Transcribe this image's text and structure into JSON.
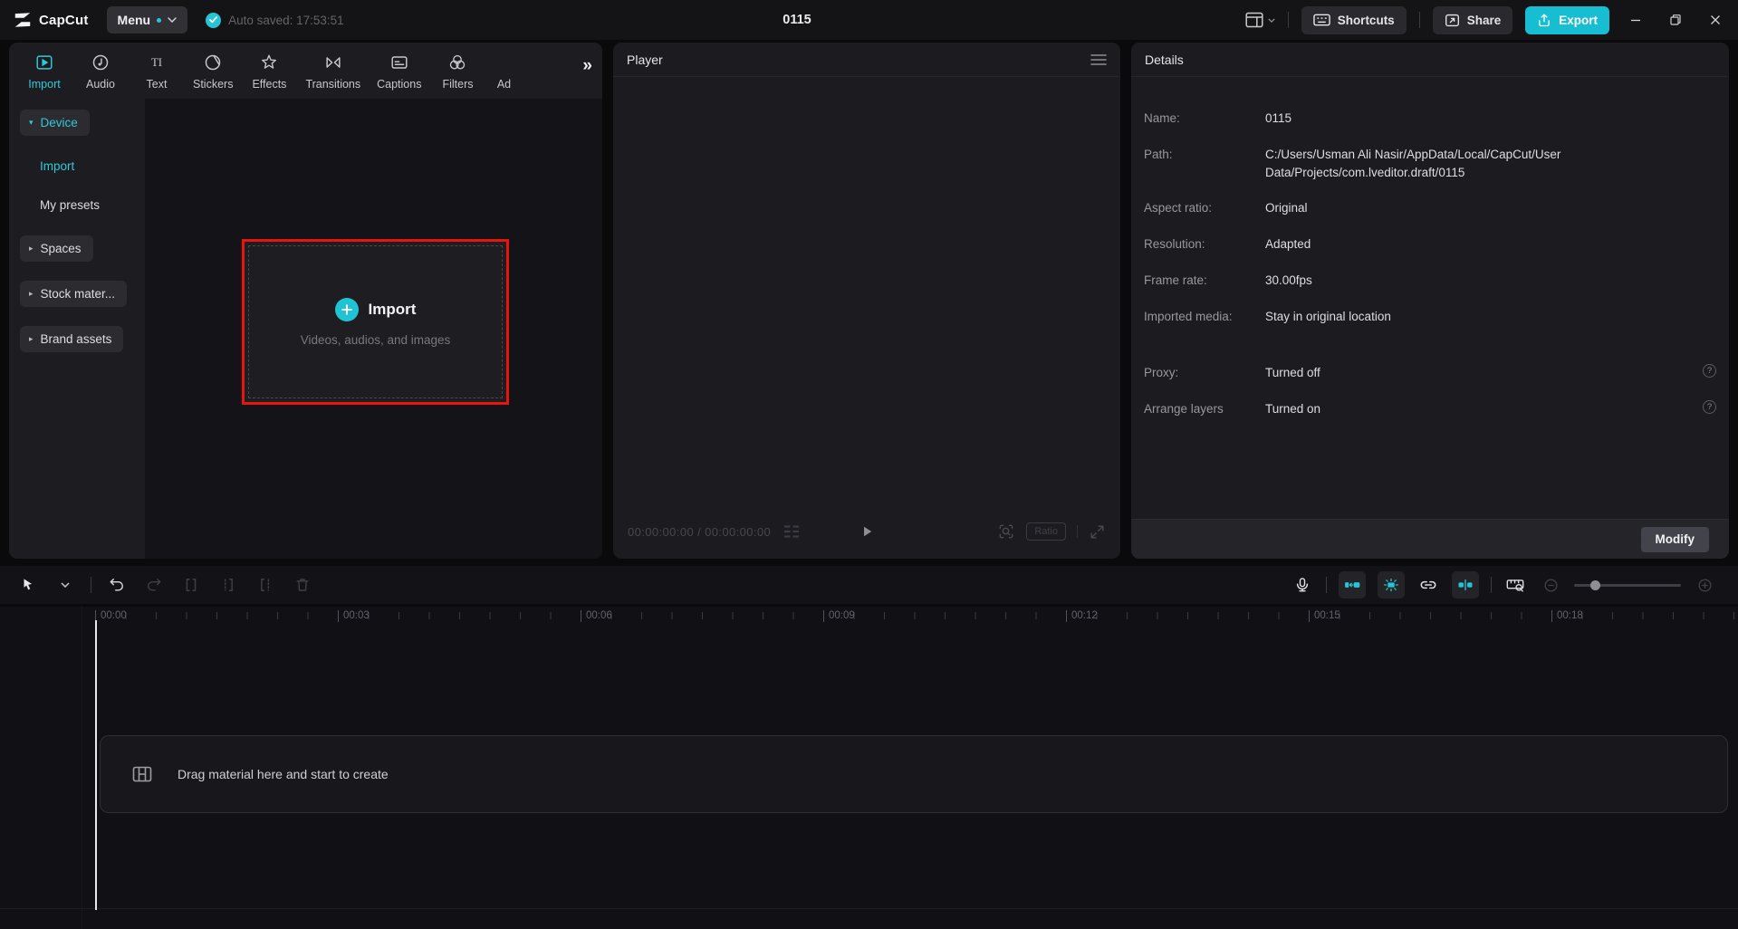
{
  "colors": {
    "accent": "#25c5d6",
    "export_button": "#17bed2",
    "import_border_red": "#e8150d",
    "selected_text": "#2fc9d8"
  },
  "topbar": {
    "logo_text": "CapCut",
    "menu_label": "Menu",
    "autosave_text": "Auto saved: 17:53:51",
    "project_title": "0115",
    "shortcuts_label": "Shortcuts",
    "share_label": "Share",
    "export_label": "Export"
  },
  "media_tabs": {
    "overflow_label": "»",
    "items": [
      {
        "label": "Import",
        "active": true
      },
      {
        "label": "Audio",
        "active": false
      },
      {
        "label": "Text",
        "active": false
      },
      {
        "label": "Stickers",
        "active": false
      },
      {
        "label": "Effects",
        "active": false
      },
      {
        "label": "Transitions",
        "active": false
      },
      {
        "label": "Captions",
        "active": false
      },
      {
        "label": "Filters",
        "active": false
      },
      {
        "label": "Ad",
        "active": false
      }
    ]
  },
  "sidebar": {
    "device_group_label": "Device",
    "device_items": [
      {
        "label": "Import",
        "selected": true
      },
      {
        "label": "My presets",
        "selected": false
      }
    ],
    "collapsed_groups": [
      {
        "label": "Spaces"
      },
      {
        "label": "Stock mater..."
      },
      {
        "label": "Brand assets"
      }
    ]
  },
  "import_zone": {
    "title": "Import",
    "subtitle": "Videos, audios, and images"
  },
  "player": {
    "title": "Player",
    "timecode": "00:00:00:00 / 00:00:00:00",
    "ratio_label": "Ratio"
  },
  "details": {
    "title": "Details",
    "rows": [
      {
        "label": "Name:",
        "value": "0115"
      },
      {
        "label": "Path:",
        "value": "C:/Users/Usman Ali Nasir/AppData/Local/CapCut/User Data/Projects/com.lveditor.draft/0115"
      },
      {
        "label": "Aspect ratio:",
        "value": "Original"
      },
      {
        "label": "Resolution:",
        "value": "Adapted"
      },
      {
        "label": "Frame rate:",
        "value": "30.00fps"
      },
      {
        "label": "Imported media:",
        "value": "Stay in original location"
      },
      {
        "label": "Proxy:",
        "value": "Turned off"
      },
      {
        "label": "Arrange layers",
        "value": "Turned on"
      }
    ],
    "modify_label": "Modify"
  },
  "timeline": {
    "ruler_labels": [
      "00:00",
      "00:03",
      "00:06",
      "00:09",
      "00:12",
      "00:15",
      "00:18"
    ],
    "dropzone_text": "Drag material here and start to create"
  }
}
